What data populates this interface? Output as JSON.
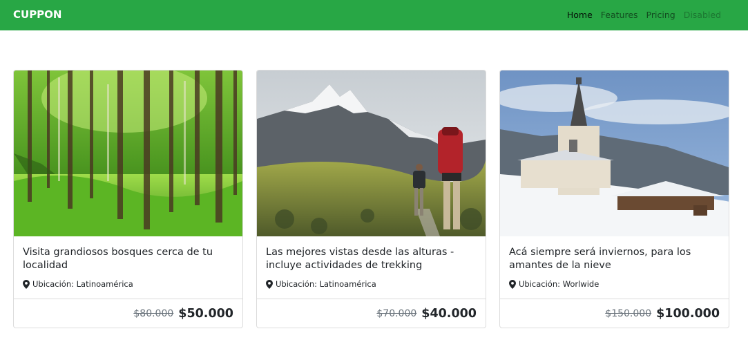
{
  "navbar": {
    "brand": "CUPPON",
    "links": [
      {
        "label": "Home"
      },
      {
        "label": "Features"
      },
      {
        "label": "Pricing"
      },
      {
        "label": "Disabled"
      }
    ],
    "background": "#28a745"
  },
  "cards": [
    {
      "title": "Visita grandiosos bosques cerca de tu localidad",
      "location": "Ubicación: Latinoamérica",
      "old_price": "$80.000",
      "new_price": "$50.000",
      "image": "forest-image"
    },
    {
      "title": "Las mejores vistas desde las alturas - incluye actividades de trekking",
      "location": "Ubicación: Latinoamérica",
      "old_price": "$70.000",
      "new_price": "$40.000",
      "image": "mountain-hikers-image"
    },
    {
      "title": "Acá siempre será inviernos, para los amantes de la nieve",
      "location": "Ubicación: Worlwide",
      "old_price": "$150.000",
      "new_price": "$100.000",
      "image": "snowy-church-image"
    }
  ],
  "icons": {
    "location": "map-marker-icon"
  }
}
